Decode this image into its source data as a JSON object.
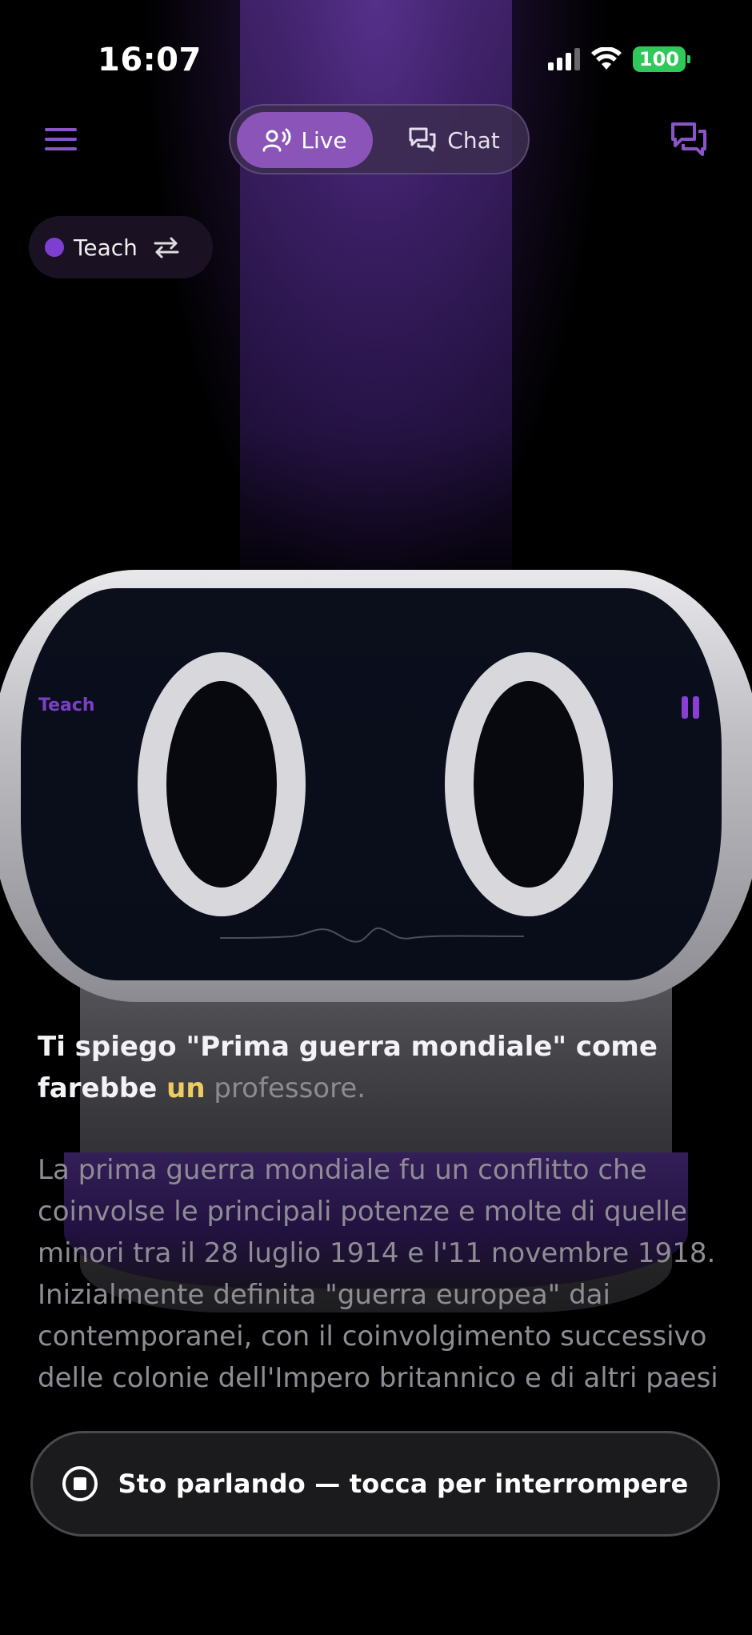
{
  "status_bar": {
    "time": "16:07",
    "battery": "100"
  },
  "nav": {
    "live_label": "Live",
    "chat_label": "Chat"
  },
  "mode_chip": {
    "label": "Teach"
  },
  "robot": {
    "mode_label": "Teach"
  },
  "message": {
    "headline_part1": "Ti spiego \"Prima guerra mondiale\" come farebbe ",
    "headline_highlight": "un",
    "headline_dim": " professore.",
    "body": "La prima guerra mondiale fu un conflitto che coinvolse le principali potenze e molte di quelle minori tra il 28 luglio 1914 e l'11 novembre 1918. Inizialmente definita \"guerra europea\" dai contemporanei, con il coinvolgimento successivo delle colonie dell'Impero britannico e di altri paesi extraeuropei tra cui gli Stati Uniti d'America"
  },
  "action_button": {
    "label": "Sto parlando — tocca per interrompere"
  },
  "colors": {
    "accent": "#8a54b8",
    "highlight": "#f0cc60",
    "battery": "#30c85a"
  }
}
